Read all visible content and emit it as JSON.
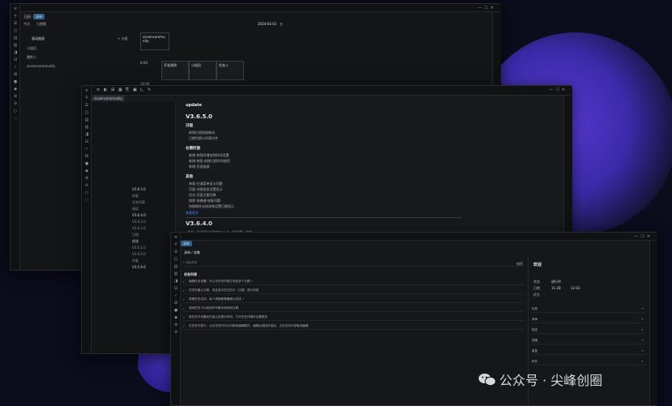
{
  "win1": {
    "sidebar_icons": [
      "≡",
      "⚲",
      "☰",
      "◫",
      "▤",
      "▥",
      "◨",
      "⊟",
      "✓",
      "⊞",
      "●",
      "◆",
      "⊕",
      "⊘",
      "○",
      "◌"
    ],
    "tabs": [
      "日历",
      "清单"
    ],
    "toolbar": {
      "today": "今天",
      "view": "日视图",
      "date": "2024-03-01",
      "week": "五"
    },
    "left_list": {
      "header": "滚动链接",
      "header_right": "+ 分组",
      "items": [
        "小组员",
        "属性人",
        "sixsencommunity"
      ]
    },
    "event_card": "sixsencommu nity",
    "time_labels": [
      "8:00",
      "10:00"
    ],
    "grid_cells": [
      "开发规则",
      "小组员",
      "任务人"
    ]
  },
  "win2": {
    "toolbar_icons": [
      "≡",
      "◐",
      "⊞",
      "▦",
      "⎘",
      "▣",
      "◺",
      "✎"
    ],
    "tab": "sixsencommunity",
    "heading": "update",
    "version1": "V3.6.5.0",
    "sections": [
      {
        "title": "日程",
        "items": [
          "新增日程拖放移动",
          "日期切换与列表对齐"
        ]
      },
      {
        "title": "右侧栏面",
        "items": [
          "新增-按钮时增加到时间设置",
          "新增-按钮-创建日程时间使用",
          "新增-页面链接"
        ]
      },
      {
        "title": "其他",
        "items": [
          "修复-右键菜单显示问题",
          "页面-详细信息设置显示",
          "优化-页面主题切换",
          "搜索-快捷键-修复问题",
          "快捷键补全修改和设置日期显示"
        ]
      }
    ],
    "more_link": "查看更多",
    "version2": "V3.6.4.0",
    "version2_item": "全局一致页面访问时的右上方（时间等）功能",
    "versions_nav": [
      "V3.6.5.0",
      "修复",
      "任务列表",
      "阅读",
      "V3.6.4.0",
      "V3.6.3.0",
      "V3.6.2.0",
      "日程",
      "优化",
      "V3.6.1.0",
      "V3.6.0.0",
      "修复",
      "V3.5.9.0"
    ]
  },
  "win3": {
    "tab": "清单",
    "breadcrumb": "清单 / 收集",
    "input_placeholder": "+ 添加任务",
    "sort_label": "排序",
    "group_label": "任务列表",
    "tasks": [
      "编辑任务设置，可以在任务列表中添加多个日期 ✓",
      "任务在截止日期，将会显示在日历中（日程）提示完成",
      "周期任务支持，每个周期都需要确认完成 ✓",
      "使用任务卡片拖放时可移动到其他日期",
      "新任务可设置优先级以及提示时间，打开任务详情可设置更多",
      "在任务列表中，点击任务时可以切换到编辑模式，编辑后按回车保存，点击任务外部取消编辑"
    ],
    "detail": {
      "title": "欢迎",
      "status_label": "状态",
      "status_value": "进行中",
      "date_label": "日期",
      "date_from": "11-28",
      "date_to": "12-03",
      "priority_label": "优先",
      "fields": [
        "标签",
        "清单",
        "描述",
        "提醒",
        "重复",
        "附件"
      ]
    }
  },
  "watermark": "公众号 · 尖峰创圈",
  "colors": {
    "accent": "#2ec27e",
    "link": "#3b82f6",
    "desktop": "#0b0c1c",
    "orb": "#5a3bd8"
  }
}
